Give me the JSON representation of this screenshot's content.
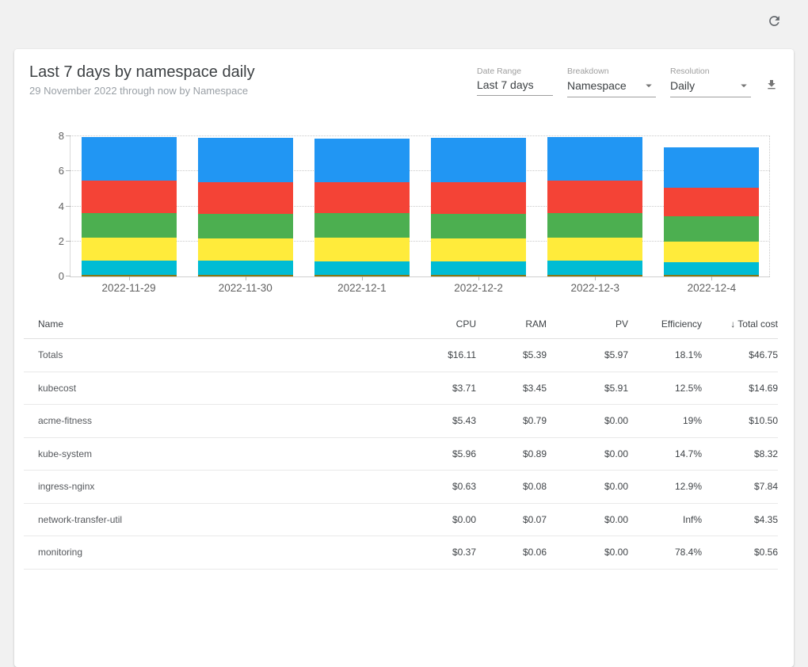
{
  "topbar": {
    "refresh_icon": "refresh"
  },
  "header": {
    "title": "Last 7 days by namespace daily",
    "subtitle": "29 November 2022 through now by Namespace",
    "controls": [
      {
        "label": "Date Range",
        "value": "Last 7 days",
        "has_caret": false
      },
      {
        "label": "Breakdown",
        "value": "Namespace",
        "has_caret": true
      },
      {
        "label": "Resolution",
        "value": "Daily",
        "has_caret": true
      }
    ],
    "download_icon": "download"
  },
  "chart_data": {
    "type": "bar",
    "stacked": true,
    "title": "",
    "xlabel": "",
    "ylabel": "",
    "ylim": [
      0,
      8
    ],
    "yticks": [
      0,
      2,
      4,
      6,
      8
    ],
    "grid": "dotted-horizontal",
    "legend_position": "none",
    "categories": [
      "2022-11-29",
      "2022-11-30",
      "2022-12-1",
      "2022-12-2",
      "2022-12-3",
      "2022-12-4"
    ],
    "series": [
      {
        "name": "monitoring",
        "color": "#827717",
        "values": [
          0.09,
          0.09,
          0.09,
          0.09,
          0.09,
          0.1
        ]
      },
      {
        "name": "network-transfer-util",
        "color": "#00bcd4",
        "values": [
          0.82,
          0.8,
          0.79,
          0.78,
          0.8,
          0.72
        ]
      },
      {
        "name": "ingress-nginx",
        "color": "#ffeb3b",
        "values": [
          1.3,
          1.3,
          1.32,
          1.3,
          1.33,
          1.18
        ]
      },
      {
        "name": "kube-system",
        "color": "#4caf50",
        "values": [
          1.42,
          1.4,
          1.4,
          1.42,
          1.42,
          1.43
        ]
      },
      {
        "name": "acme-fitness",
        "color": "#f44336",
        "values": [
          1.84,
          1.8,
          1.78,
          1.8,
          1.82,
          1.63
        ]
      },
      {
        "name": "kubecost",
        "color": "#2196f3",
        "values": [
          2.48,
          2.5,
          2.5,
          2.52,
          2.49,
          2.3
        ]
      }
    ]
  },
  "table": {
    "columns": [
      {
        "label": "Name"
      },
      {
        "label": "CPU"
      },
      {
        "label": "RAM"
      },
      {
        "label": "PV"
      },
      {
        "label": "Efficiency"
      },
      {
        "label": "Total cost",
        "sort_icon": "↓"
      }
    ],
    "rows": [
      [
        "Totals",
        "$16.11",
        "$5.39",
        "$5.97",
        "18.1%",
        "$46.75"
      ],
      [
        "kubecost",
        "$3.71",
        "$3.45",
        "$5.91",
        "12.5%",
        "$14.69"
      ],
      [
        "acme-fitness",
        "$5.43",
        "$0.79",
        "$0.00",
        "19%",
        "$10.50"
      ],
      [
        "kube-system",
        "$5.96",
        "$0.89",
        "$0.00",
        "14.7%",
        "$8.32"
      ],
      [
        "ingress-nginx",
        "$0.63",
        "$0.08",
        "$0.00",
        "12.9%",
        "$7.84"
      ],
      [
        "network-transfer-util",
        "$0.00",
        "$0.07",
        "$0.00",
        "Inf%",
        "$4.35"
      ],
      [
        "monitoring",
        "$0.37",
        "$0.06",
        "$0.00",
        "78.4%",
        "$0.56"
      ]
    ]
  }
}
